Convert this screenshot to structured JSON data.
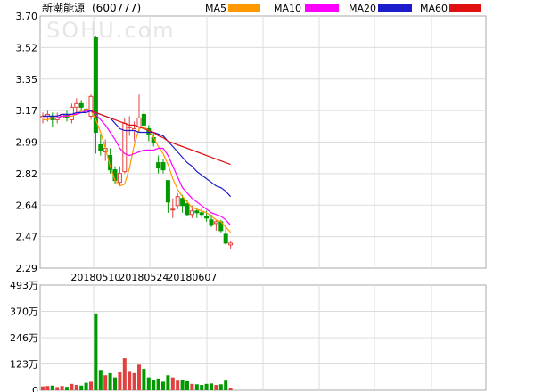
{
  "chart_data": {
    "type": "candlestick",
    "title": "新潮能源",
    "code": "(600777)",
    "watermark": "SOHU.com",
    "legend": [
      {
        "name": "MA5",
        "color": "#ff9900"
      },
      {
        "name": "MA10",
        "color": "#ff00ff"
      },
      {
        "name": "MA20",
        "color": "#1c1ccc"
      },
      {
        "name": "MA60",
        "color": "#e01010"
      }
    ],
    "up_color": "#e04040",
    "down_color": "#009900",
    "price_axis": {
      "ylim": [
        2.29,
        3.7
      ],
      "ticks": [
        "3.70",
        "3.52",
        "3.35",
        "3.17",
        "2.99",
        "2.82",
        "2.64",
        "2.47",
        "2.29"
      ]
    },
    "volume_axis": {
      "ylim": [
        0,
        493
      ],
      "unit": "万",
      "ticks": [
        "493万",
        "370万",
        "246万",
        "123万",
        "0"
      ]
    },
    "date_labels": [
      {
        "index": 11,
        "label": "20180510"
      },
      {
        "index": 21,
        "label": "20180524"
      },
      {
        "index": 31,
        "label": "20180607"
      }
    ],
    "candles": [
      {
        "o": 3.13,
        "h": 3.16,
        "l": 3.1,
        "c": 3.14,
        "v": 18
      },
      {
        "o": 3.14,
        "h": 3.17,
        "l": 3.11,
        "c": 3.15,
        "v": 20
      },
      {
        "o": 3.14,
        "h": 3.16,
        "l": 3.08,
        "c": 3.12,
        "v": 22
      },
      {
        "o": 3.12,
        "h": 3.16,
        "l": 3.1,
        "c": 3.13,
        "v": 15
      },
      {
        "o": 3.13,
        "h": 3.18,
        "l": 3.11,
        "c": 3.15,
        "v": 20
      },
      {
        "o": 3.15,
        "h": 3.17,
        "l": 3.11,
        "c": 3.13,
        "v": 16
      },
      {
        "o": 3.12,
        "h": 3.21,
        "l": 3.1,
        "c": 3.19,
        "v": 30
      },
      {
        "o": 3.19,
        "h": 3.24,
        "l": 3.15,
        "c": 3.21,
        "v": 25
      },
      {
        "o": 3.21,
        "h": 3.23,
        "l": 3.17,
        "c": 3.19,
        "v": 22
      },
      {
        "o": 3.18,
        "h": 3.26,
        "l": 3.15,
        "c": 3.17,
        "v": 35
      },
      {
        "o": 3.14,
        "h": 3.26,
        "l": 3.12,
        "c": 3.25,
        "v": 40
      },
      {
        "o": 3.58,
        "h": 3.59,
        "l": 2.93,
        "c": 3.05,
        "v": 360
      },
      {
        "o": 2.98,
        "h": 3.04,
        "l": 2.92,
        "c": 2.95,
        "v": 95
      },
      {
        "o": 2.94,
        "h": 3.01,
        "l": 2.89,
        "c": 2.96,
        "v": 70
      },
      {
        "o": 2.92,
        "h": 2.96,
        "l": 2.82,
        "c": 2.84,
        "v": 80
      },
      {
        "o": 2.84,
        "h": 2.86,
        "l": 2.76,
        "c": 2.78,
        "v": 60
      },
      {
        "o": 2.77,
        "h": 2.86,
        "l": 2.75,
        "c": 2.82,
        "v": 85
      },
      {
        "o": 2.83,
        "h": 3.13,
        "l": 2.82,
        "c": 3.1,
        "v": 150
      },
      {
        "o": 3.08,
        "h": 3.14,
        "l": 3.03,
        "c": 3.08,
        "v": 90
      },
      {
        "o": 3.06,
        "h": 3.11,
        "l": 3.0,
        "c": 3.07,
        "v": 80
      },
      {
        "o": 3.08,
        "h": 3.26,
        "l": 3.05,
        "c": 3.13,
        "v": 120
      },
      {
        "o": 3.15,
        "h": 3.18,
        "l": 3.07,
        "c": 3.09,
        "v": 100
      },
      {
        "o": 3.07,
        "h": 3.09,
        "l": 3.0,
        "c": 3.04,
        "v": 60
      },
      {
        "o": 3.02,
        "h": 3.05,
        "l": 2.97,
        "c": 2.99,
        "v": 50
      },
      {
        "o": 2.88,
        "h": 2.92,
        "l": 2.82,
        "c": 2.85,
        "v": 55
      },
      {
        "o": 2.88,
        "h": 2.9,
        "l": 2.82,
        "c": 2.84,
        "v": 40
      },
      {
        "o": 2.78,
        "h": 2.78,
        "l": 2.6,
        "c": 2.66,
        "v": 70
      },
      {
        "o": 2.62,
        "h": 2.68,
        "l": 2.57,
        "c": 2.62,
        "v": 60
      },
      {
        "o": 2.64,
        "h": 2.71,
        "l": 2.62,
        "c": 2.69,
        "v": 45
      },
      {
        "o": 2.68,
        "h": 2.7,
        "l": 2.6,
        "c": 2.64,
        "v": 50
      },
      {
        "o": 2.65,
        "h": 2.67,
        "l": 2.58,
        "c": 2.59,
        "v": 42
      },
      {
        "o": 2.59,
        "h": 2.64,
        "l": 2.57,
        "c": 2.61,
        "v": 30
      },
      {
        "o": 2.61,
        "h": 2.62,
        "l": 2.57,
        "c": 2.6,
        "v": 28
      },
      {
        "o": 2.6,
        "h": 2.63,
        "l": 2.57,
        "c": 2.59,
        "v": 25
      },
      {
        "o": 2.58,
        "h": 2.61,
        "l": 2.55,
        "c": 2.57,
        "v": 30
      },
      {
        "o": 2.56,
        "h": 2.59,
        "l": 2.52,
        "c": 2.53,
        "v": 32
      },
      {
        "o": 2.54,
        "h": 2.56,
        "l": 2.5,
        "c": 2.55,
        "v": 25
      },
      {
        "o": 2.55,
        "h": 2.56,
        "l": 2.49,
        "c": 2.5,
        "v": 28
      },
      {
        "o": 2.48,
        "h": 2.53,
        "l": 2.42,
        "c": 2.43,
        "v": 45
      },
      {
        "o": 2.42,
        "h": 2.44,
        "l": 2.4,
        "c": 2.43,
        "v": 12
      }
    ],
    "ma": {
      "MA5": [
        3.12,
        3.12,
        3.13,
        3.13,
        3.14,
        3.14,
        3.14,
        3.15,
        3.17,
        3.18,
        3.17,
        3.12,
        3.05,
        2.96,
        2.86,
        2.78,
        2.75,
        2.76,
        2.85,
        2.98,
        3.07,
        3.08,
        3.06,
        3.02,
        2.97,
        2.93,
        2.87,
        2.79,
        2.73,
        2.69,
        2.66,
        2.63,
        2.62,
        2.61,
        2.6,
        2.58,
        2.56,
        2.55,
        2.52,
        2.49
      ],
      "MA10": [
        3.13,
        3.13,
        3.13,
        3.13,
        3.14,
        3.14,
        3.15,
        3.15,
        3.16,
        3.17,
        3.17,
        3.15,
        3.12,
        3.09,
        3.05,
        3.01,
        2.96,
        2.93,
        2.92,
        2.93,
        2.94,
        2.95,
        2.95,
        2.95,
        2.96,
        2.96,
        2.92,
        2.86,
        2.8,
        2.74,
        2.71,
        2.68,
        2.66,
        2.64,
        2.62,
        2.6,
        2.59,
        2.58,
        2.56,
        2.53
      ],
      "MA20": [
        3.14,
        3.14,
        3.14,
        3.14,
        3.15,
        3.15,
        3.15,
        3.16,
        3.16,
        3.16,
        3.17,
        3.16,
        3.15,
        3.14,
        3.13,
        3.1,
        3.07,
        3.06,
        3.06,
        3.06,
        3.05,
        3.05,
        3.05,
        3.05,
        3.04,
        3.03,
        3.0,
        2.97,
        2.94,
        2.91,
        2.88,
        2.86,
        2.83,
        2.81,
        2.79,
        2.77,
        2.75,
        2.74,
        2.72,
        2.69
      ],
      "MA60": [
        null,
        null,
        null,
        null,
        null,
        null,
        null,
        null,
        null,
        null,
        3.17,
        3.16,
        3.15,
        3.14,
        3.13,
        3.12,
        3.11,
        3.1,
        3.09,
        3.09,
        3.08,
        3.07,
        3.06,
        3.05,
        3.03,
        3.02,
        3.0,
        2.99,
        2.98,
        2.97,
        2.96,
        2.95,
        2.94,
        2.93,
        2.92,
        2.91,
        2.9,
        2.89,
        2.88,
        2.87
      ]
    }
  }
}
